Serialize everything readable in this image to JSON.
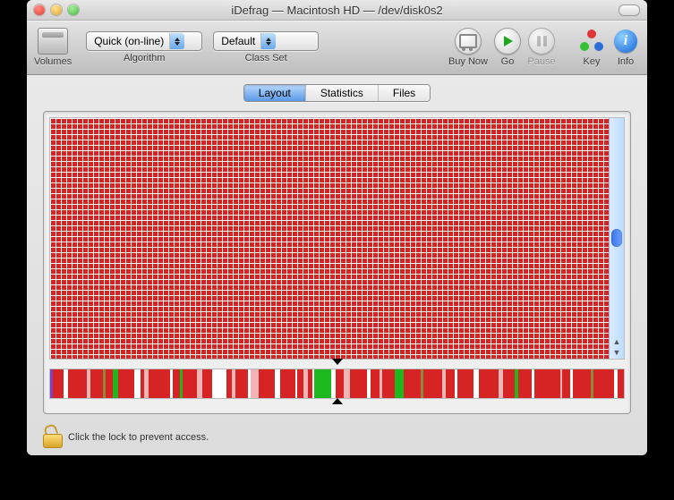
{
  "window": {
    "title": "iDefrag — Macintosh HD — /dev/disk0s2"
  },
  "toolbar": {
    "volumes_label": "Volumes",
    "algorithm_label": "Algorithm",
    "algorithm_value": "Quick (on-line)",
    "classset_label": "Class Set",
    "classset_value": "Default",
    "buynow_label": "Buy Now",
    "go_label": "Go",
    "pause_label": "Pause",
    "key_label": "Key",
    "info_label": "Info"
  },
  "tabs": {
    "layout": "Layout",
    "statistics": "Statistics",
    "files": "Files",
    "active": "layout"
  },
  "lock": {
    "text": "Click the lock to prevent access."
  },
  "colors": {
    "frag_red": "#d62323",
    "frag_green": "#1eb81e",
    "frag_pink": "#f2b5b5",
    "frag_white": "#ffffff",
    "frag_olive": "#8a8a3a",
    "frag_purple": "#7b3fbf"
  },
  "overview_stripes": [
    {
      "c": "frag_purple",
      "w": 0.4
    },
    {
      "c": "frag_red",
      "w": 1.8
    },
    {
      "c": "frag_white",
      "w": 0.6
    },
    {
      "c": "frag_red",
      "w": 3.1
    },
    {
      "c": "frag_pink",
      "w": 0.5
    },
    {
      "c": "frag_red",
      "w": 2.0
    },
    {
      "c": "frag_olive",
      "w": 0.4
    },
    {
      "c": "frag_red",
      "w": 1.2
    },
    {
      "c": "frag_green",
      "w": 0.8
    },
    {
      "c": "frag_red",
      "w": 2.5
    },
    {
      "c": "frag_white",
      "w": 1.0
    },
    {
      "c": "frag_red",
      "w": 0.7
    },
    {
      "c": "frag_pink",
      "w": 0.6
    },
    {
      "c": "frag_red",
      "w": 3.4
    },
    {
      "c": "frag_white",
      "w": 0.5
    },
    {
      "c": "frag_red",
      "w": 1.1
    },
    {
      "c": "frag_green",
      "w": 0.5
    },
    {
      "c": "frag_red",
      "w": 2.2
    },
    {
      "c": "frag_pink",
      "w": 0.9
    },
    {
      "c": "frag_red",
      "w": 1.6
    },
    {
      "c": "frag_white",
      "w": 2.2
    },
    {
      "c": "frag_red",
      "w": 0.8
    },
    {
      "c": "frag_pink",
      "w": 0.7
    },
    {
      "c": "frag_red",
      "w": 1.9
    },
    {
      "c": "frag_white",
      "w": 0.5
    },
    {
      "c": "frag_pink",
      "w": 1.2
    },
    {
      "c": "frag_red",
      "w": 2.6
    },
    {
      "c": "frag_white",
      "w": 0.9
    },
    {
      "c": "frag_red",
      "w": 2.3
    },
    {
      "c": "frag_white",
      "w": 0.4
    },
    {
      "c": "frag_red",
      "w": 1.0
    },
    {
      "c": "frag_pink",
      "w": 0.6
    },
    {
      "c": "frag_red",
      "w": 0.7
    },
    {
      "c": "frag_white",
      "w": 0.4
    },
    {
      "c": "frag_green",
      "w": 2.6
    },
    {
      "c": "frag_white",
      "w": 0.7
    },
    {
      "c": "frag_red",
      "w": 1.3
    },
    {
      "c": "frag_pink",
      "w": 1.0
    },
    {
      "c": "frag_red",
      "w": 2.8
    },
    {
      "c": "frag_white",
      "w": 0.5
    },
    {
      "c": "frag_red",
      "w": 1.4
    },
    {
      "c": "frag_pink",
      "w": 0.5
    },
    {
      "c": "frag_red",
      "w": 2.0
    },
    {
      "c": "frag_green",
      "w": 1.4
    },
    {
      "c": "frag_red",
      "w": 2.7
    },
    {
      "c": "frag_olive",
      "w": 0.4
    },
    {
      "c": "frag_red",
      "w": 3.0
    },
    {
      "c": "frag_pink",
      "w": 0.5
    },
    {
      "c": "frag_red",
      "w": 1.5
    },
    {
      "c": "frag_white",
      "w": 0.4
    },
    {
      "c": "frag_red",
      "w": 2.6
    },
    {
      "c": "frag_white",
      "w": 0.8
    },
    {
      "c": "frag_red",
      "w": 3.2
    },
    {
      "c": "frag_pink",
      "w": 0.7
    },
    {
      "c": "frag_red",
      "w": 1.8
    },
    {
      "c": "frag_green",
      "w": 0.6
    },
    {
      "c": "frag_red",
      "w": 2.1
    },
    {
      "c": "frag_white",
      "w": 0.5
    },
    {
      "c": "frag_red",
      "w": 4.0
    },
    {
      "c": "frag_pink",
      "w": 0.4
    },
    {
      "c": "frag_red",
      "w": 1.2
    },
    {
      "c": "frag_white",
      "w": 0.4
    },
    {
      "c": "frag_red",
      "w": 2.9
    },
    {
      "c": "frag_olive",
      "w": 0.4
    },
    {
      "c": "frag_red",
      "w": 3.3
    },
    {
      "c": "frag_white",
      "w": 0.5
    },
    {
      "c": "frag_red",
      "w": 1.0
    }
  ]
}
